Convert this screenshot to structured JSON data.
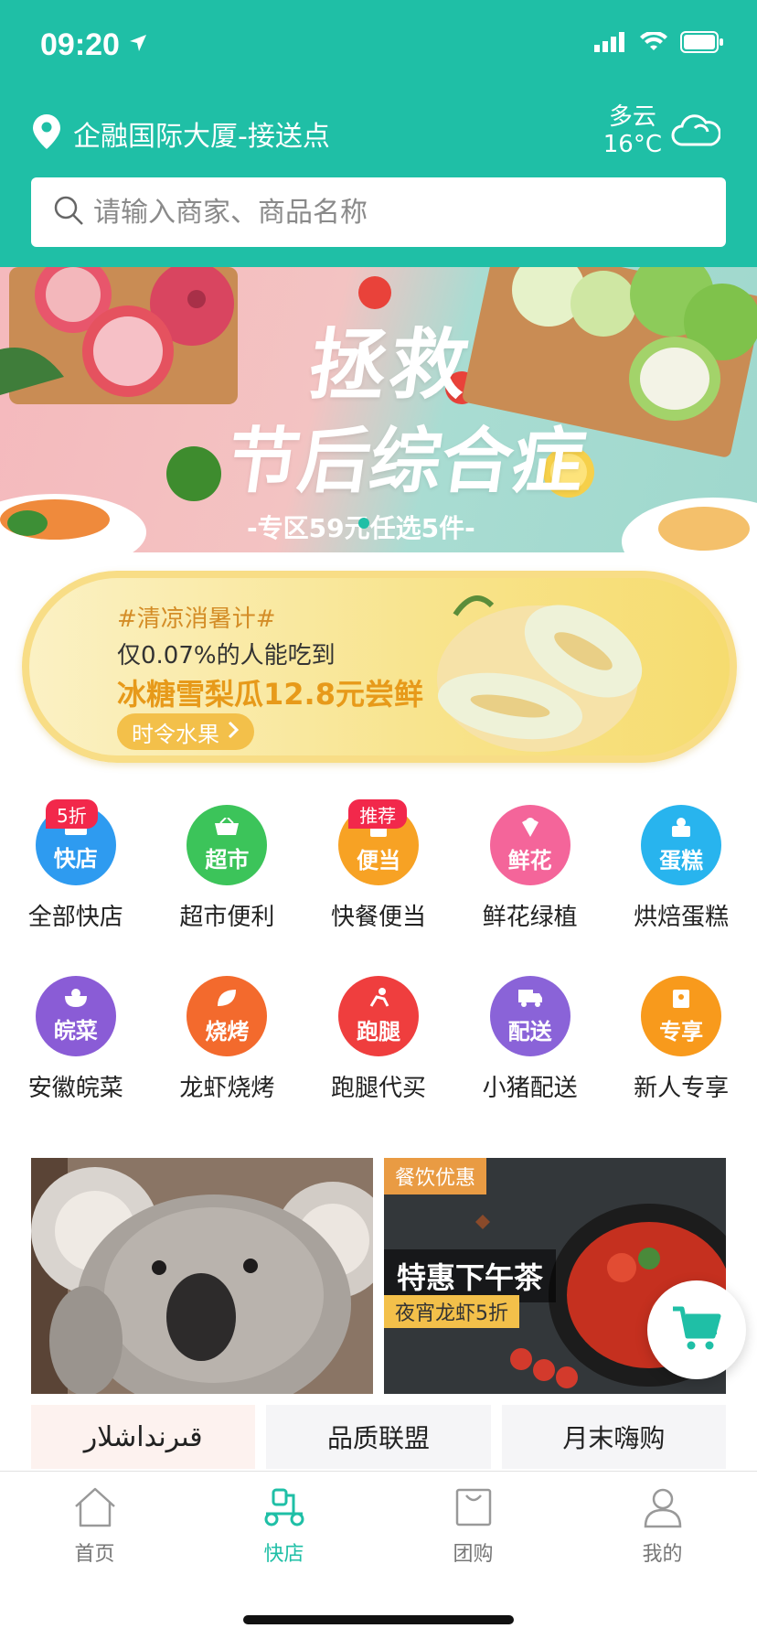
{
  "status_bar": {
    "time": "09:20"
  },
  "header": {
    "location": "企融国际大厦-接送点",
    "weather": {
      "desc": "多云",
      "temp": "16°C"
    },
    "search": {
      "placeholder": "请输入商家、商品名称"
    }
  },
  "hero": {
    "title_line1": "拯救",
    "title_line2": "节后综合症",
    "subtitle": "-专区59元任选5件-"
  },
  "promo": {
    "tag": "#清凉消暑计#",
    "line1": "仅0.07%的人能吃到",
    "line2": "冰糖雪梨瓜12.8元尝鲜",
    "button": "时令水果"
  },
  "categories": [
    {
      "icon": "bag-icon",
      "circle_text": "快店",
      "label": "全部快店",
      "badge": "5折",
      "color": "#2e9bf0"
    },
    {
      "icon": "basket-icon",
      "circle_text": "超市",
      "label": "超市便利",
      "badge": "",
      "color": "#3cc45a"
    },
    {
      "icon": "cup-icon",
      "circle_text": "便当",
      "label": "快餐便当",
      "badge": "推荐",
      "color": "#f7a224"
    },
    {
      "icon": "flower-icon",
      "circle_text": "鲜花",
      "label": "鲜花绿植",
      "badge": "",
      "color": "#f4659a"
    },
    {
      "icon": "cake-icon",
      "circle_text": "蛋糕",
      "label": "烘焙蛋糕",
      "badge": "",
      "color": "#28b4ee"
    },
    {
      "icon": "bowl-icon",
      "circle_text": "皖菜",
      "label": "安徽皖菜",
      "badge": "",
      "color": "#8a5cd6"
    },
    {
      "icon": "leaf-icon",
      "circle_text": "烧烤",
      "label": "龙虾烧烤",
      "badge": "",
      "color": "#f36a2d"
    },
    {
      "icon": "runner-icon",
      "circle_text": "跑腿",
      "label": "跑腿代买",
      "badge": "",
      "color": "#ef3e3e"
    },
    {
      "icon": "truck-icon",
      "circle_text": "配送",
      "label": "小猪配送",
      "badge": "",
      "color": "#8a63d8"
    },
    {
      "icon": "gift-icon",
      "circle_text": "专享",
      "label": "新人专享",
      "badge": "",
      "color": "#f89a1c"
    }
  ],
  "cards": {
    "food": {
      "tag": "餐饮优惠",
      "title": "特惠下午茶",
      "sub": "夜宵龙虾5折"
    }
  },
  "tiles": [
    "قىرنداشلار",
    "品质联盟",
    "月末嗨购"
  ],
  "tabbar": [
    {
      "icon": "home-icon",
      "label": "首页",
      "active": false
    },
    {
      "icon": "scooter-icon",
      "label": "快店",
      "active": true
    },
    {
      "icon": "shopping-bag-icon",
      "label": "团购",
      "active": false
    },
    {
      "icon": "user-icon",
      "label": "我的",
      "active": false
    }
  ],
  "colors": {
    "brand": "#1fbfa6",
    "badge": "#f2284b"
  }
}
